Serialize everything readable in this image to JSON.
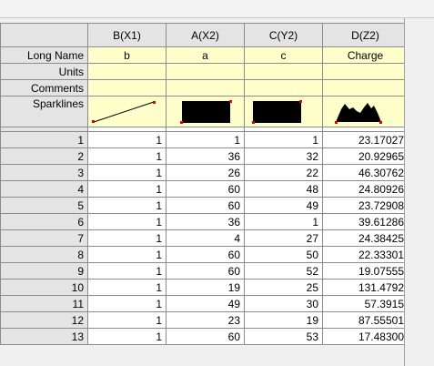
{
  "columns": [
    {
      "header": "B(X1)",
      "long_name": "b",
      "units": "",
      "comments": "",
      "sparkline": "line"
    },
    {
      "header": "A(X2)",
      "long_name": "a",
      "units": "",
      "comments": "",
      "sparkline": "dense"
    },
    {
      "header": "C(Y2)",
      "long_name": "c",
      "units": "",
      "comments": "",
      "sparkline": "dense"
    },
    {
      "header": "D(Z2)",
      "long_name": "Charge",
      "units": "",
      "comments": "",
      "sparkline": "peaks"
    }
  ],
  "labels": {
    "long_name": "Long Name",
    "units": "Units",
    "comments": "Comments",
    "sparklines": "Sparklines"
  },
  "rows": [
    {
      "n": "1",
      "b": "1",
      "a": "1",
      "c": "1",
      "d": "23.17027"
    },
    {
      "n": "2",
      "b": "1",
      "a": "36",
      "c": "32",
      "d": "20.92965"
    },
    {
      "n": "3",
      "b": "1",
      "a": "26",
      "c": "22",
      "d": "46.30762"
    },
    {
      "n": "4",
      "b": "1",
      "a": "60",
      "c": "48",
      "d": "24.80926"
    },
    {
      "n": "5",
      "b": "1",
      "a": "60",
      "c": "49",
      "d": "23.72908"
    },
    {
      "n": "6",
      "b": "1",
      "a": "36",
      "c": "1",
      "d": "39.61286"
    },
    {
      "n": "7",
      "b": "1",
      "a": "4",
      "c": "27",
      "d": "24.38425"
    },
    {
      "n": "8",
      "b": "1",
      "a": "60",
      "c": "50",
      "d": "22.33301"
    },
    {
      "n": "9",
      "b": "1",
      "a": "60",
      "c": "52",
      "d": "19.07555"
    },
    {
      "n": "10",
      "b": "1",
      "a": "19",
      "c": "25",
      "d": "131.4792"
    },
    {
      "n": "11",
      "b": "1",
      "a": "49",
      "c": "30",
      "d": "57.3915"
    },
    {
      "n": "12",
      "b": "1",
      "a": "23",
      "c": "19",
      "d": "87.55501"
    },
    {
      "n": "13",
      "b": "1",
      "a": "60",
      "c": "53",
      "d": "17.48300"
    }
  ],
  "colors": {
    "header_bg": "#e4e4e4",
    "meta_bg": "#ffffcc",
    "grid": "#8c8c8c",
    "sparkline_endpoint": "#e00000"
  }
}
